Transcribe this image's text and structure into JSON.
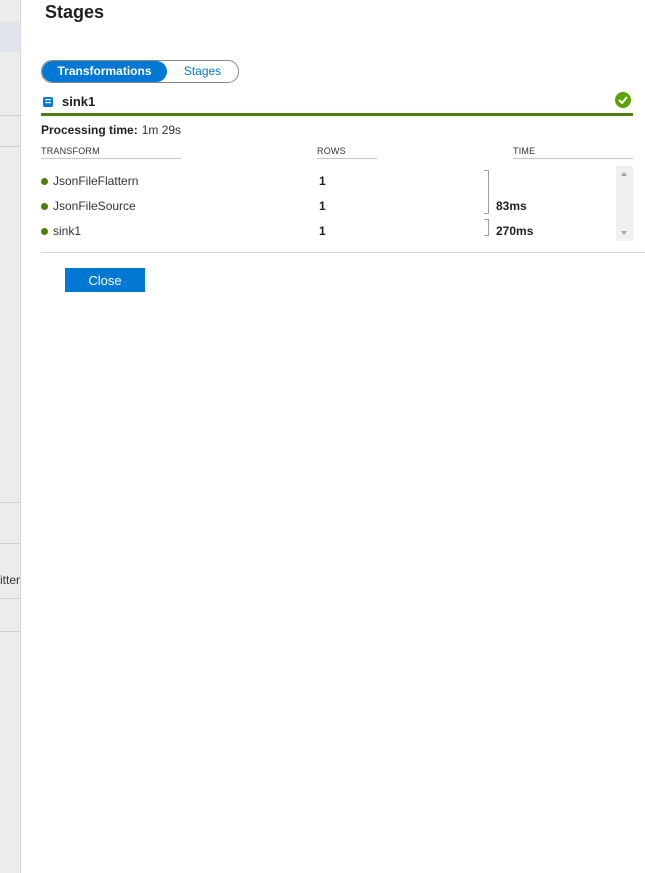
{
  "backdrop": {
    "fragment_text": "itter"
  },
  "panel": {
    "title": "Stages",
    "tabs": [
      {
        "label": "Transformations",
        "active": true
      },
      {
        "label": "Stages",
        "active": false
      }
    ],
    "sink": {
      "name": "sink1",
      "status": "succeeded"
    },
    "processing_time": {
      "label": "Processing time:",
      "value": "1m 29s"
    },
    "table": {
      "columns": [
        "TRANSFORM",
        "ROWS",
        "TIME"
      ],
      "rows": [
        {
          "transform": "JsonFileFlattern",
          "rows": "1",
          "time": ""
        },
        {
          "transform": "JsonFileSource",
          "rows": "1",
          "time": "83ms"
        },
        {
          "transform": "sink1",
          "rows": "1",
          "time": "270ms"
        }
      ]
    },
    "close_label": "Close"
  },
  "colors": {
    "accent": "#0078d4",
    "success": "#57a300",
    "status_green": "#4b7d0f"
  }
}
